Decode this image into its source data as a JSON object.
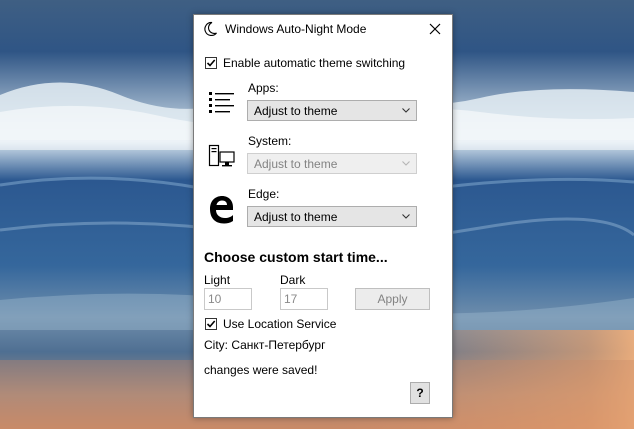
{
  "window": {
    "title": "Windows Auto-Night Mode"
  },
  "switching": {
    "label": "Enable automatic theme switching",
    "checked": true
  },
  "apps": {
    "label": "Apps:",
    "value": "Adjust to theme",
    "enabled": true
  },
  "system": {
    "label": "System:",
    "value": "Adjust to theme",
    "enabled": false
  },
  "edge": {
    "label": "Edge:",
    "value": "Adjust to theme",
    "enabled": true
  },
  "custom_time": {
    "heading": "Choose custom start time...",
    "light_label": "Light",
    "light_value": "10",
    "dark_label": "Dark",
    "dark_value": "17",
    "apply_label": "Apply"
  },
  "location": {
    "label": "Use Location Service",
    "checked": true,
    "city_text": "City: Санкт-Петербург"
  },
  "status": {
    "text": "changes were saved!"
  },
  "help": {
    "label": "?"
  },
  "icons": {
    "title": "moon-icon",
    "close": "close-icon",
    "apps": "list-icon",
    "system": "computer-icon",
    "edge": "edge-logo-icon",
    "dropdown": "chevron-down-icon"
  },
  "colors": {
    "window_bg": "#ffffff",
    "disabled_text": "#838383",
    "control_bg": "#e5e5e5"
  }
}
